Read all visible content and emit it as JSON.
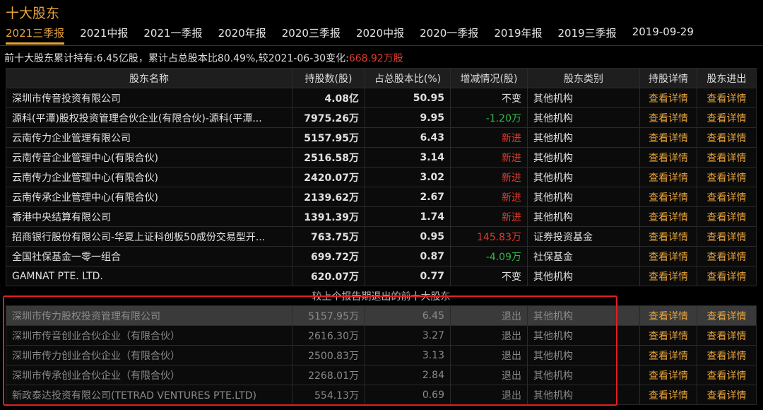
{
  "title": "十大股东",
  "tabs": [
    "2021三季报",
    "2021中报",
    "2021一季报",
    "2020年报",
    "2020三季报",
    "2020中报",
    "2020一季报",
    "2019年报",
    "2019三季报",
    "2019-09-29"
  ],
  "summary": {
    "prefix": "前十大股东累计持有:6.45亿股，累计占总股本比80.49%,较2021-06-30变化:",
    "change": "668.92万股"
  },
  "headers": [
    "股东名称",
    "持股数(股)",
    "占总股本比(%)",
    "增减情况(股)",
    "股东类别",
    "持股详情",
    "股东进出"
  ],
  "rows": [
    {
      "name": "深圳市传音投资有限公司",
      "shares": "4.08亿",
      "pct": "50.95",
      "change": "不变",
      "cc": "",
      "type": "其他机构"
    },
    {
      "name": "源科(平潭)股权投资管理合伙企业(有限合伙)-源科(平潭...",
      "shares": "7975.26万",
      "pct": "9.95",
      "change": "-1.20万",
      "cc": "green",
      "type": "其他机构"
    },
    {
      "name": "云南传力企业管理有限公司",
      "shares": "5157.95万",
      "pct": "6.43",
      "change": "新进",
      "cc": "red",
      "type": "其他机构"
    },
    {
      "name": "云南传音企业管理中心(有限合伙)",
      "shares": "2516.58万",
      "pct": "3.14",
      "change": "新进",
      "cc": "red",
      "type": "其他机构"
    },
    {
      "name": "云南传力企业管理中心(有限合伙)",
      "shares": "2420.07万",
      "pct": "3.02",
      "change": "新进",
      "cc": "red",
      "type": "其他机构"
    },
    {
      "name": "云南传承企业管理中心(有限合伙)",
      "shares": "2139.62万",
      "pct": "2.67",
      "change": "新进",
      "cc": "red",
      "type": "其他机构"
    },
    {
      "name": "香港中央结算有限公司",
      "shares": "1391.39万",
      "pct": "1.74",
      "change": "新进",
      "cc": "red",
      "type": "其他机构"
    },
    {
      "name": "招商银行股份有限公司-华夏上证科创板50成份交易型开...",
      "shares": "763.75万",
      "pct": "0.95",
      "change": "145.83万",
      "cc": "red",
      "type": "证券投资基金"
    },
    {
      "name": "全国社保基金一零一组合",
      "shares": "699.72万",
      "pct": "0.87",
      "change": "-4.09万",
      "cc": "green",
      "type": "社保基金"
    },
    {
      "name": "GAMNAT PTE. LTD.",
      "shares": "620.07万",
      "pct": "0.77",
      "change": "不变",
      "cc": "",
      "type": "其他机构"
    }
  ],
  "exit_section_label": "较上个报告期退出的前十大股东",
  "exit_rows": [
    {
      "name": "深圳市传力股权投资管理有限公司",
      "shares": "5157.95万",
      "pct": "6.45",
      "change": "退出",
      "type": "其他机构"
    },
    {
      "name": "深圳市传音创业合伙企业（有限合伙）",
      "shares": "2616.30万",
      "pct": "3.27",
      "change": "退出",
      "type": "其他机构"
    },
    {
      "name": "深圳市传力创业合伙企业（有限合伙）",
      "shares": "2500.83万",
      "pct": "3.13",
      "change": "退出",
      "type": "其他机构"
    },
    {
      "name": "深圳市传承创业合伙企业（有限合伙）",
      "shares": "2268.01万",
      "pct": "2.84",
      "change": "退出",
      "type": "其他机构"
    },
    {
      "name": "新政泰达投资有限公司(TETRAD VENTURES PTE.LTD)",
      "shares": "554.13万",
      "pct": "0.69",
      "change": "退出",
      "type": "其他机构"
    }
  ],
  "link_label": "查看详情",
  "colors": {
    "accent": "#e8a33b",
    "up": "#e03b2e",
    "down": "#37b34a",
    "highlight_box": "#e02020"
  }
}
